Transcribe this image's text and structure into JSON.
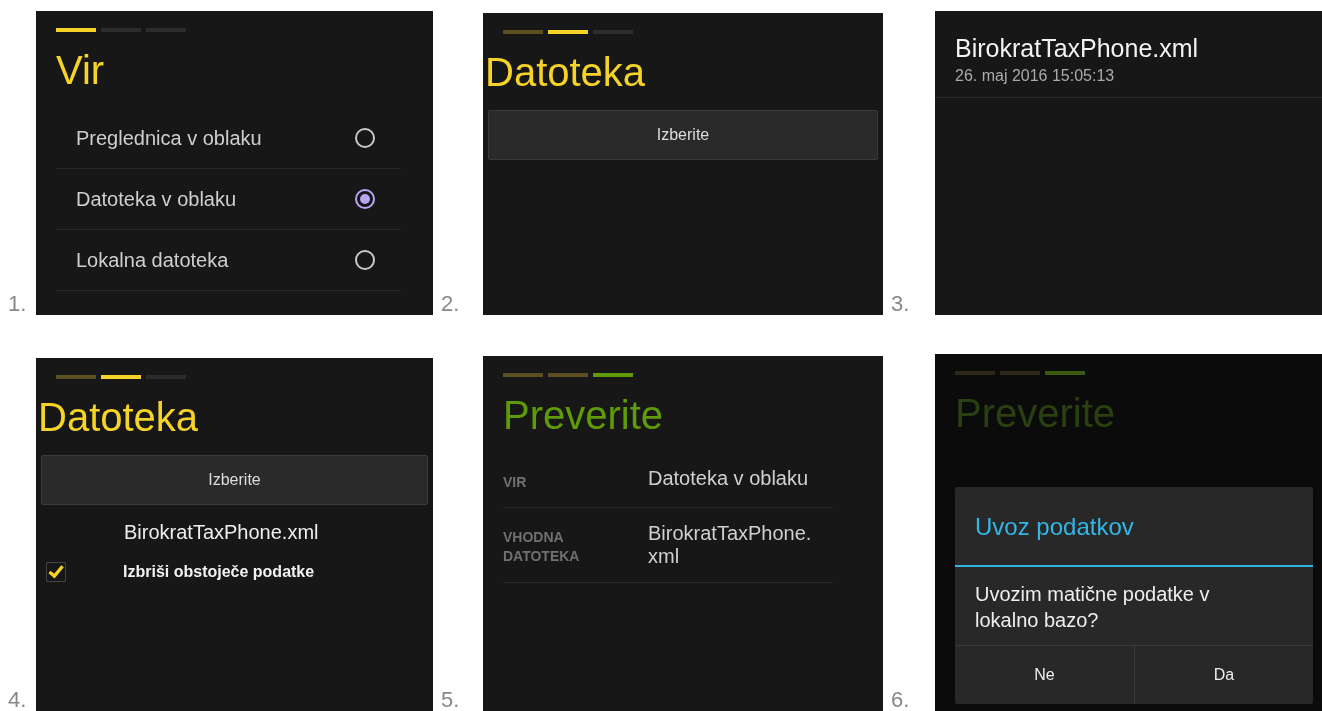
{
  "panels": [
    {
      "number": "1.",
      "kind": "source",
      "dimmed": false,
      "steps": [
        {
          "selected": true
        },
        {
          "selected": false
        },
        {
          "selected": false
        }
      ],
      "title": "Vir",
      "options": [
        {
          "label": "Preglednica v oblaku",
          "selected": false
        },
        {
          "label": "Datoteka v oblaku",
          "selected": true
        },
        {
          "label": "Lokalna datoteka",
          "selected": false
        }
      ]
    },
    {
      "number": "2.",
      "kind": "file",
      "dimmed": false,
      "steps": [
        {
          "selected": false
        },
        {
          "selected": true
        },
        {
          "selected": false
        }
      ],
      "title": "Datoteka",
      "button": "Izberite"
    },
    {
      "number": "3.",
      "kind": "picker",
      "file": {
        "name": "BirokratTaxPhone.xml",
        "date": "26. maj 2016 15:05:13"
      }
    },
    {
      "number": "4.",
      "kind": "file",
      "dimmed": false,
      "steps": [
        {
          "selected": false
        },
        {
          "selected": true
        },
        {
          "selected": false
        }
      ],
      "title": "Datoteka",
      "button": "Izberite",
      "file": "BirokratTaxPhone.xml",
      "option": {
        "label": "Izbriši obstoječe podatke",
        "checked": true
      }
    },
    {
      "number": "5.",
      "kind": "review",
      "dimmed": false,
      "steps": [
        {
          "selected": false
        },
        {
          "selected": false
        },
        {
          "selected": true
        }
      ],
      "title": "Preverite",
      "rows": [
        {
          "label": "VIR",
          "value": "Datoteka v oblaku"
        },
        {
          "label": "VHODNA DATOTEKA",
          "value": "BirokratTaxPhone. xml"
        }
      ]
    },
    {
      "number": "6.",
      "kind": "review",
      "dimmed": true,
      "steps": [
        {
          "selected": false
        },
        {
          "selected": false
        },
        {
          "selected": true
        }
      ],
      "title": "Preverite",
      "dialog": {
        "title": "Uvoz podatkov",
        "message": "Uvozim matične podatke v lokalno bazo?",
        "buttons": [
          "Ne",
          "Da"
        ]
      }
    }
  ]
}
